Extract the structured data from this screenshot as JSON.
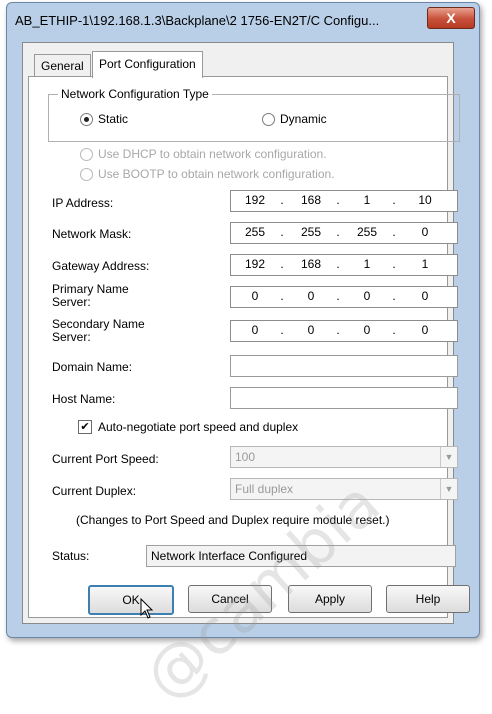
{
  "window": {
    "title": "AB_ETHIP-1\\192.168.1.3\\Backplane\\2 1756-EN2T/C Configu...",
    "close_label": "X"
  },
  "tabs": [
    {
      "label": "General",
      "active": false
    },
    {
      "label": "Port Configuration",
      "active": true
    }
  ],
  "network_type": {
    "legend": "Network Configuration Type",
    "static_label": "Static",
    "dynamic_label": "Dynamic",
    "selected": "Static"
  },
  "dhcp_option": "Use DHCP to obtain network configuration.",
  "bootp_option": "Use BOOTP to obtain network configuration.",
  "fields": {
    "ip_address": {
      "label": "IP Address:",
      "octets": [
        "192",
        "168",
        "1",
        "10"
      ]
    },
    "network_mask": {
      "label": "Network Mask:",
      "octets": [
        "255",
        "255",
        "255",
        "0"
      ]
    },
    "gateway_address": {
      "label": "Gateway Address:",
      "octets": [
        "192",
        "168",
        "1",
        "1"
      ]
    },
    "primary_name_server": {
      "label_line1": "Primary Name",
      "label_line2": "Server:",
      "octets": [
        "0",
        "0",
        "0",
        "0"
      ]
    },
    "secondary_name_server": {
      "label_line1": "Secondary Name",
      "label_line2": "Server:",
      "octets": [
        "0",
        "0",
        "0",
        "0"
      ]
    },
    "domain_name": {
      "label": "Domain Name:",
      "value": ""
    },
    "host_name": {
      "label": "Host Name:",
      "value": ""
    }
  },
  "auto_negotiate": {
    "label": "Auto-negotiate port speed and duplex",
    "checked": true,
    "mark": "✔"
  },
  "port_speed": {
    "label": "Current Port Speed:",
    "value": "100",
    "arrow": "▼"
  },
  "duplex": {
    "label": "Current Duplex:",
    "value": "Full duplex",
    "arrow": "▼"
  },
  "reset_note": "(Changes to Port Speed and Duplex require module reset.)",
  "status": {
    "label": "Status:",
    "value": "Network Interface Configured"
  },
  "buttons": {
    "ok": "OK",
    "cancel": "Cancel",
    "apply": "Apply",
    "help": "Help"
  },
  "watermark": "@cambia",
  "colors": {
    "title_bar": "#b9cfe8",
    "close_button": "#c8503a",
    "default_button_border": "#3c7fb1"
  },
  "icons": {
    "close": "close-icon",
    "cursor": "mouse-pointer-icon"
  }
}
